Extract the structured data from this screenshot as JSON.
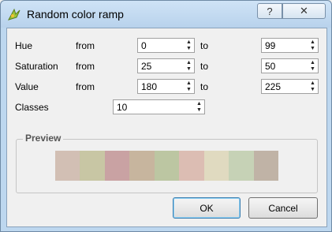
{
  "window": {
    "title": "Random color ramp",
    "help_label": "?",
    "close_label": "✕"
  },
  "rows": [
    {
      "label": "Hue",
      "from_label": "from",
      "from_value": "0",
      "to_label": "to",
      "to_value": "99"
    },
    {
      "label": "Saturation",
      "from_label": "from",
      "from_value": "25",
      "to_label": "to",
      "to_value": "50"
    },
    {
      "label": "Value",
      "from_label": "from",
      "from_value": "180",
      "to_label": "to",
      "to_value": "225"
    }
  ],
  "classes": {
    "label": "Classes",
    "value": "10"
  },
  "preview": {
    "title": "Preview",
    "swatches": [
      "#d2bfb4",
      "#c8c6a4",
      "#c9a2a3",
      "#c7b59e",
      "#bcc6a2",
      "#dcbdb3",
      "#e0dac0",
      "#c6d2b6",
      "#c0b3a6"
    ]
  },
  "buttons": {
    "ok": "OK",
    "cancel": "Cancel"
  }
}
